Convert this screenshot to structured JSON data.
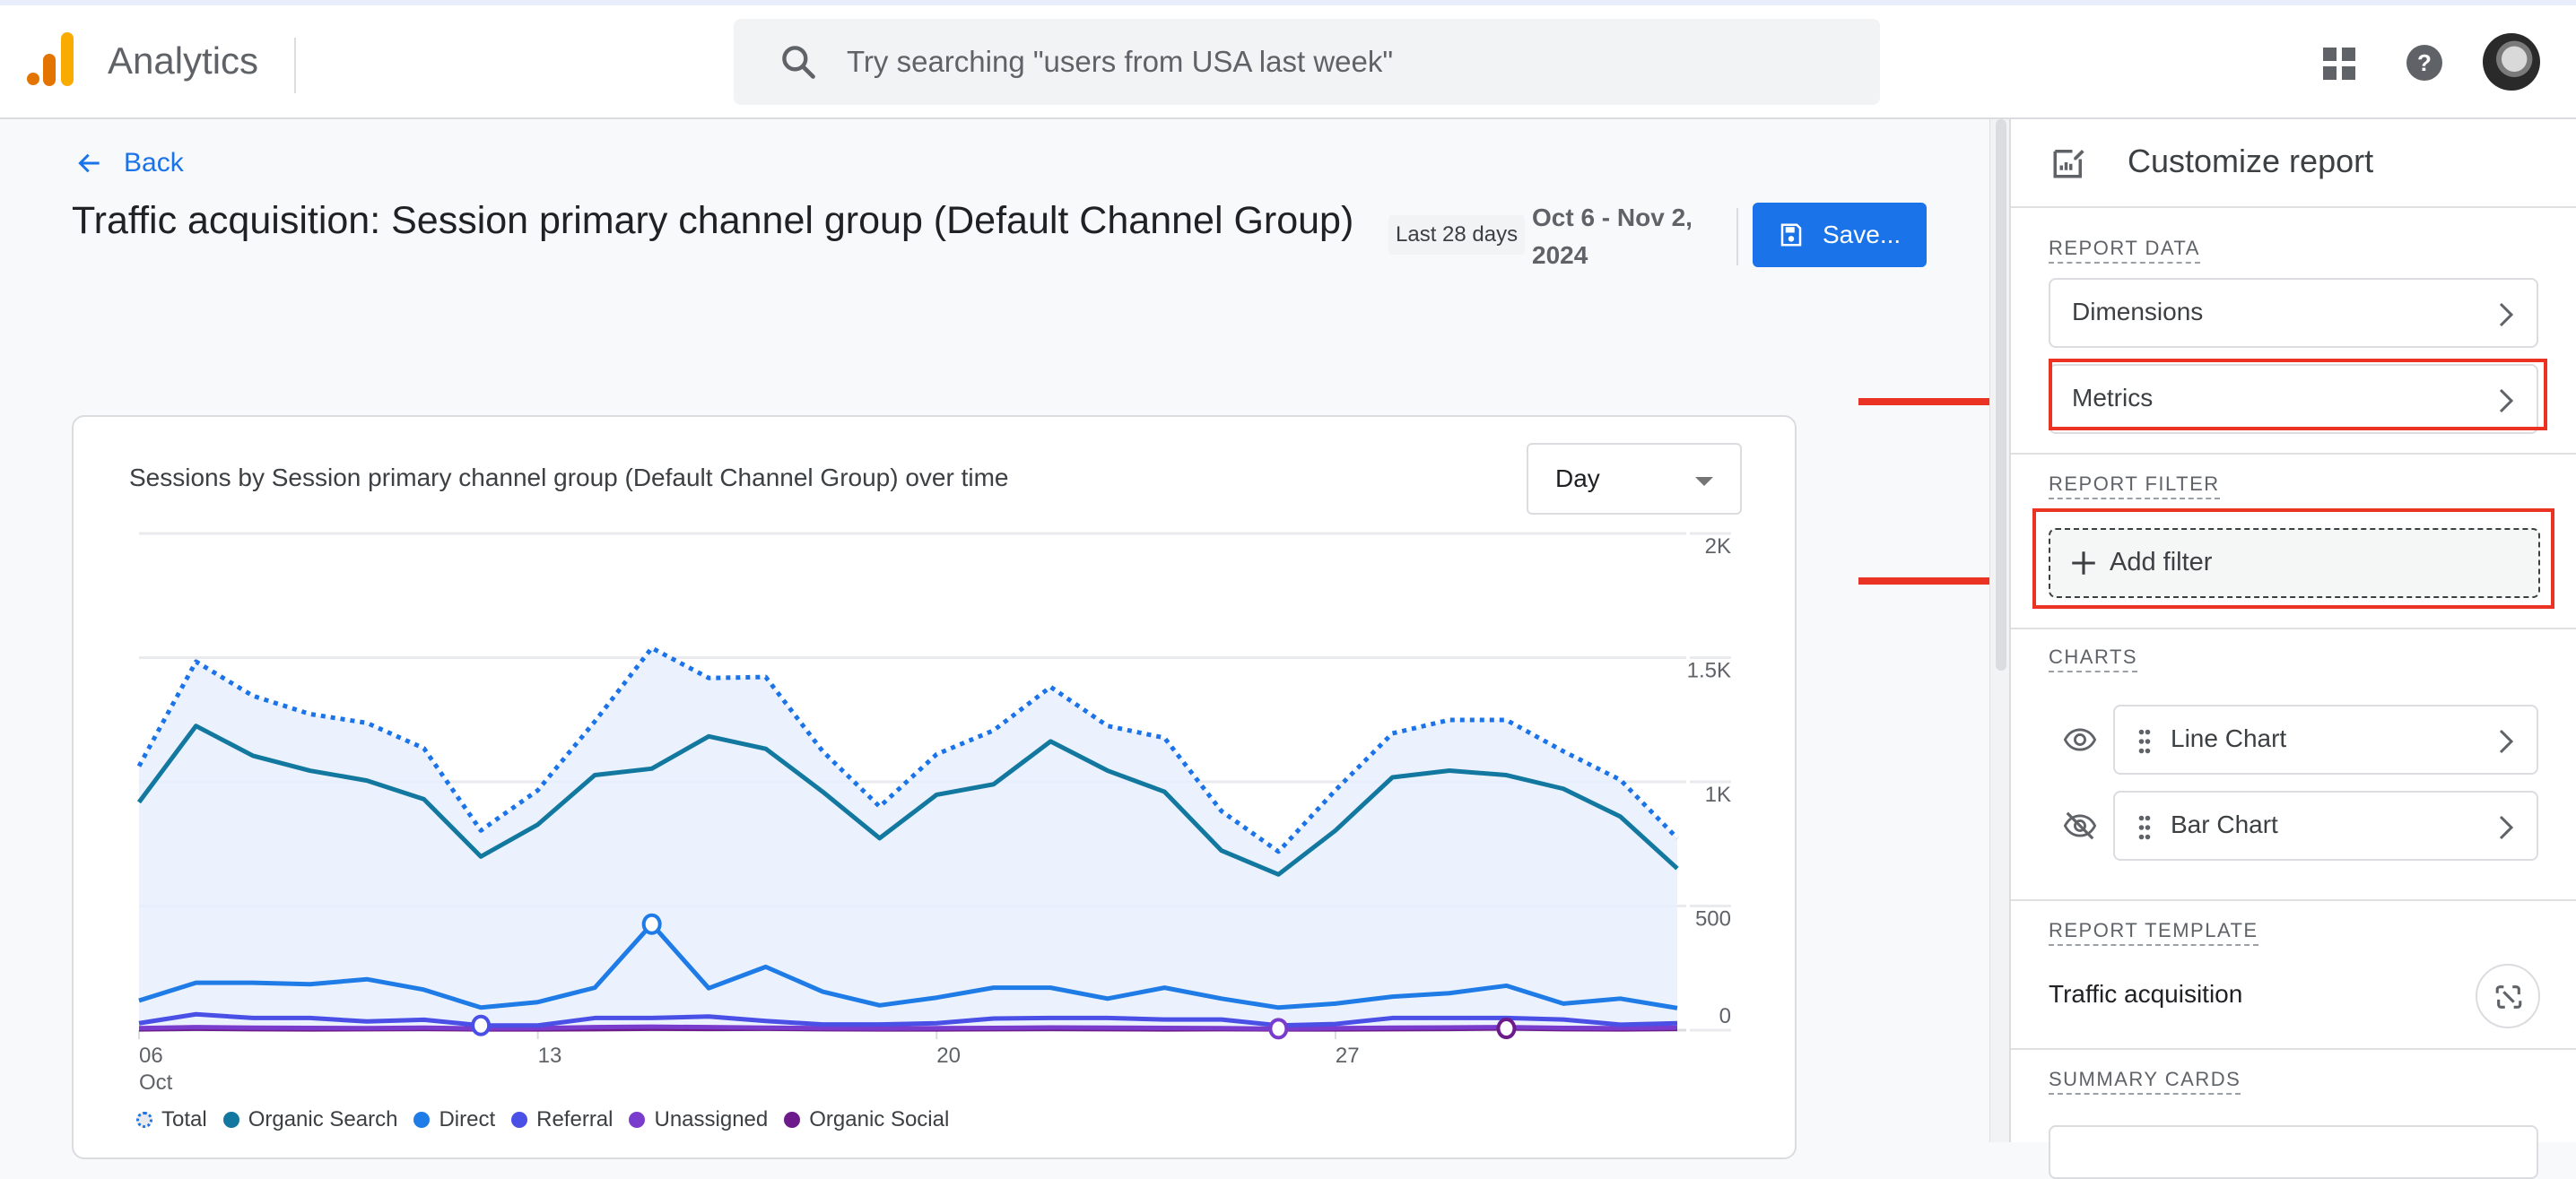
{
  "header": {
    "app_name": "Analytics",
    "search_placeholder": "Try searching \"users from USA last week\"",
    "icons": [
      "analytics-logo-icon",
      "search-icon",
      "apps-grid-icon",
      "help-icon",
      "account-avatar"
    ]
  },
  "page": {
    "back_label": "Back",
    "title": "Traffic acquisition: Session primary channel group (Default Channel Group)",
    "date_chip": "Last 28 days",
    "date_range": "Oct 6 - Nov 2, 2024",
    "save_label": "Save..."
  },
  "chart_card": {
    "title": "Sessions by Session primary channel group (Default Channel Group) over time",
    "granularity": "Day"
  },
  "chart_data": {
    "type": "line",
    "title": "Sessions by Session primary channel group (Default Channel Group) over time",
    "xlabel": "",
    "ylabel": "",
    "ylim": [
      0,
      2000
    ],
    "y_ticks": [
      {
        "value": 0,
        "label": "0"
      },
      {
        "value": 500,
        "label": "500"
      },
      {
        "value": 1000,
        "label": "1K"
      },
      {
        "value": 1500,
        "label": "1.5K"
      },
      {
        "value": 2000,
        "label": "2K"
      }
    ],
    "x_ticks": [
      {
        "index": 0,
        "label": "06",
        "sublabel": "Oct"
      },
      {
        "index": 7,
        "label": "13",
        "sublabel": ""
      },
      {
        "index": 14,
        "label": "20",
        "sublabel": ""
      },
      {
        "index": 21,
        "label": "27",
        "sublabel": ""
      }
    ],
    "x": [
      "Oct 6",
      "Oct 7",
      "Oct 8",
      "Oct 9",
      "Oct 10",
      "Oct 11",
      "Oct 12",
      "Oct 13",
      "Oct 14",
      "Oct 15",
      "Oct 16",
      "Oct 17",
      "Oct 18",
      "Oct 19",
      "Oct 20",
      "Oct 21",
      "Oct 22",
      "Oct 23",
      "Oct 24",
      "Oct 25",
      "Oct 26",
      "Oct 27",
      "Oct 28",
      "Oct 29",
      "Oct 30",
      "Oct 31",
      "Nov 1",
      "Nov 2"
    ],
    "grid": true,
    "y_axis_position": "right",
    "legend_position": "bottom-left",
    "series": [
      {
        "name": "Total",
        "color": "#1a73e8",
        "style": "dotted",
        "filled": true,
        "values": [
          1063,
          1484,
          1346,
          1273,
          1237,
          1135,
          804,
          966,
          1243,
          1539,
          1418,
          1422,
          1123,
          900,
          1111,
          1207,
          1382,
          1225,
          1177,
          882,
          719,
          966,
          1195,
          1249,
          1249,
          1123,
          1008,
          773
        ]
      },
      {
        "name": "Organic Search",
        "color": "#12789f",
        "style": "solid",
        "values": [
          918,
          1225,
          1105,
          1045,
          1005,
          930,
          699,
          828,
          1027,
          1053,
          1183,
          1133,
          960,
          773,
          948,
          990,
          1163,
          1045,
          960,
          723,
          627,
          804,
          1018,
          1045,
          1027,
          972,
          860,
          651
        ]
      },
      {
        "name": "Direct",
        "color": "#1f7be6",
        "style": "solid",
        "marker_index": 9,
        "values": [
          119,
          191,
          191,
          185,
          205,
          163,
          91,
          113,
          171,
          427,
          169,
          255,
          155,
          100,
          131,
          171,
          171,
          127,
          171,
          127,
          91,
          107,
          135,
          149,
          179,
          107,
          127,
          89
        ]
      },
      {
        "name": "Referral",
        "color": "#4a50e6",
        "style": "solid",
        "marker_index": 6,
        "values": [
          28,
          64,
          49,
          49,
          35,
          42,
          19,
          19,
          49,
          49,
          55,
          37,
          23,
          23,
          28,
          47,
          49,
          49,
          43,
          43,
          19,
          25,
          49,
          49,
          49,
          43,
          22,
          28
        ]
      },
      {
        "name": "Unassigned",
        "color": "#7a3ccc",
        "style": "solid",
        "marker_index": 20,
        "values": [
          8,
          12,
          10,
          9,
          8,
          10,
          7,
          8,
          12,
          14,
          12,
          10,
          8,
          7,
          8,
          9,
          11,
          10,
          9,
          8,
          6,
          8,
          10,
          11,
          12,
          9,
          8,
          10
        ]
      },
      {
        "name": "Organic Social",
        "color": "#6d1a8a",
        "style": "solid",
        "marker_index": 24,
        "values": [
          3,
          6,
          4,
          3,
          4,
          5,
          3,
          3,
          4,
          6,
          5,
          6,
          4,
          3,
          3,
          4,
          5,
          4,
          3,
          4,
          3,
          3,
          4,
          5,
          7,
          4,
          3,
          5
        ]
      }
    ]
  },
  "panel": {
    "title": "Customize report",
    "sections": {
      "report_data": {
        "label": "REPORT DATA",
        "items": [
          "Dimensions",
          "Metrics"
        ]
      },
      "report_filter": {
        "label": "REPORT FILTER",
        "add_filter_label": "Add filter"
      },
      "charts": {
        "label": "CHARTS",
        "items": [
          {
            "label": "Line Chart",
            "visible": true
          },
          {
            "label": "Bar Chart",
            "visible": false
          }
        ]
      },
      "report_template": {
        "label": "REPORT TEMPLATE",
        "name": "Traffic acquisition"
      },
      "summary_cards": {
        "label": "SUMMARY CARDS"
      }
    }
  },
  "annotations": {
    "highlight_color": "#ea3323",
    "highlighted": [
      "Metrics",
      "Add filter"
    ]
  }
}
